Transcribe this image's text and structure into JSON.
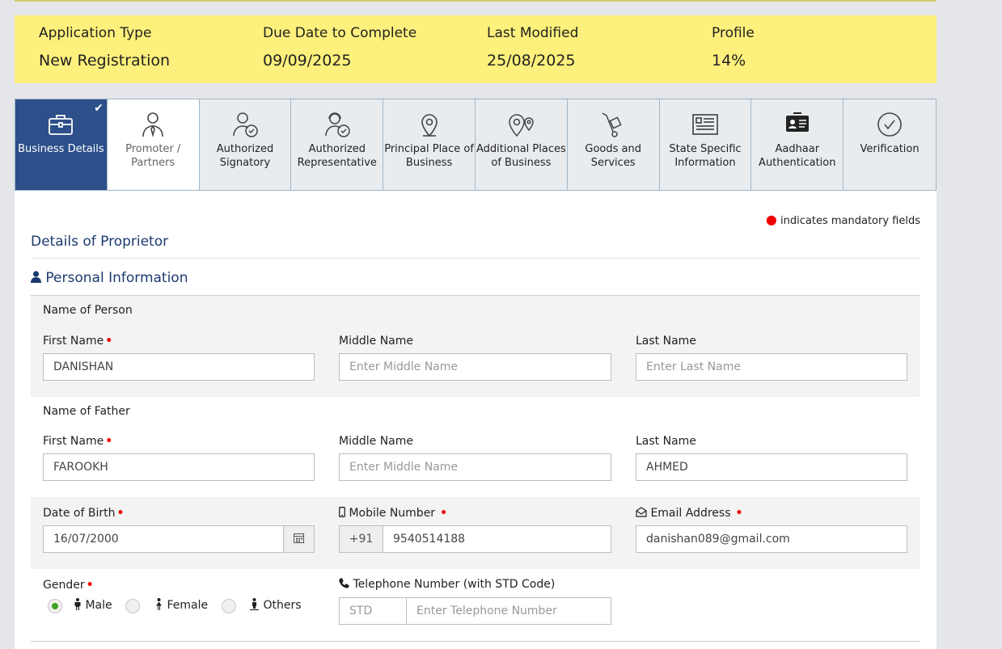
{
  "summary": {
    "app_type_label": "Application Type",
    "app_type_value": "New Registration",
    "due_label": "Due Date to Complete",
    "due_value": "09/09/2025",
    "modified_label": "Last Modified",
    "modified_value": "25/08/2025",
    "profile_label": "Profile",
    "profile_value": "14%"
  },
  "tabs": [
    {
      "label": "Business Details",
      "icon": "briefcase-icon",
      "state": "active-complete"
    },
    {
      "label": "Promoter / Partners",
      "icon": "person-tie-icon",
      "state": "visited"
    },
    {
      "label": "Authorized Signatory",
      "icon": "person-check-icon",
      "state": "pending"
    },
    {
      "label": "Authorized Representative",
      "icon": "person-headset-check-icon",
      "state": "pending"
    },
    {
      "label": "Principal Place of Business",
      "icon": "location-pin-icon",
      "state": "pending"
    },
    {
      "label": "Additional Places of Business",
      "icon": "multi-location-icon",
      "state": "pending"
    },
    {
      "label": "Goods and Services",
      "icon": "hand-truck-icon",
      "state": "pending"
    },
    {
      "label": "State Specific Information",
      "icon": "info-card-icon",
      "state": "pending"
    },
    {
      "label": "Aadhaar Authentication",
      "icon": "id-card-icon",
      "state": "pending"
    },
    {
      "label": "Verification",
      "icon": "check-circle-icon",
      "state": "pending"
    }
  ],
  "mandatory_note": "indicates mandatory fields",
  "section_title": "Details of Proprietor",
  "personal_title": "Personal Information",
  "person": {
    "group_label": "Name of Person",
    "first_label": "First Name",
    "first_value": "DANISHAN",
    "middle_label": "Middle Name",
    "middle_placeholder": "Enter Middle Name",
    "last_label": "Last Name",
    "last_placeholder": "Enter Last Name"
  },
  "father": {
    "group_label": "Name of Father",
    "first_label": "First Name",
    "first_value": "FAROOKH",
    "middle_label": "Middle Name",
    "middle_placeholder": "Enter Middle Name",
    "last_label": "Last Name",
    "last_value": "AHMED"
  },
  "contact": {
    "dob_label": "Date of Birth",
    "dob_value": "16/07/2000",
    "mobile_label": "Mobile Number",
    "mobile_prefix": "+91",
    "mobile_value": "9540514188",
    "email_label": "Email Address",
    "email_value": "danishan089@gmail.com"
  },
  "gender": {
    "label": "Gender",
    "options": [
      "Male",
      "Female",
      "Others"
    ],
    "selected": "Male"
  },
  "telephone": {
    "label": "Telephone Number (with STD Code)",
    "std_placeholder": "STD",
    "number_placeholder": "Enter Telephone Number"
  },
  "colors": {
    "summary_bg": "#fdf07c",
    "active_tab": "#2d4f8a",
    "heading": "#1c3a6e",
    "required": "#ee0000",
    "radio_on": "#3ea31f"
  }
}
